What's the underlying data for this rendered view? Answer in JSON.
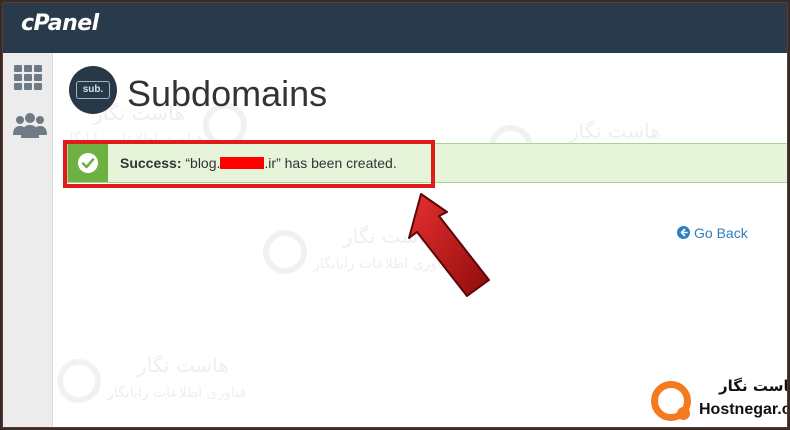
{
  "header": {
    "logo_text": "cPanel"
  },
  "sidebar": {
    "items": [
      {
        "icon": "grid-icon"
      },
      {
        "icon": "users-icon"
      }
    ]
  },
  "page": {
    "badge_text": "sub.",
    "title": "Subdomains"
  },
  "alert": {
    "label": "Success:",
    "message_prefix": " “blog.",
    "message_suffix": ".ir” has been created.",
    "accent": "#6fb043"
  },
  "go_back": {
    "label": "Go Back",
    "color": "#2f7fbf"
  },
  "watermark": {
    "line1": "هاست نگار",
    "line2": "فناوری اطلاعات رایانگار"
  },
  "brand": {
    "name_fa": "هاست نگار",
    "name_en": "Hostnegar.com",
    "color": "#f47a20"
  },
  "annotation": {
    "highlight_color": "#e01b1b",
    "arrow_color": "#c21414"
  }
}
